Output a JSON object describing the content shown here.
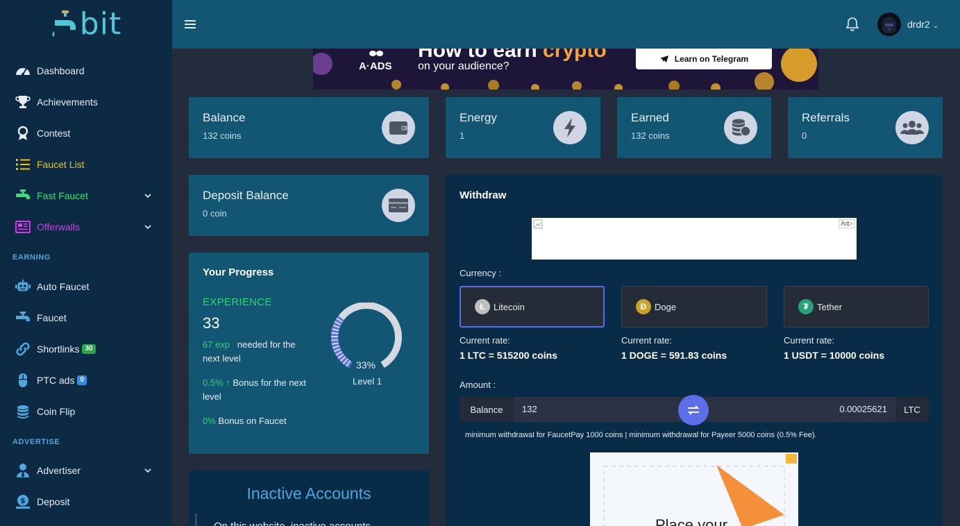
{
  "brand": {
    "logo_text": "bit"
  },
  "sidebar": {
    "items": [
      {
        "label": "Dashboard",
        "color": "#e6edf3"
      },
      {
        "label": "Achievements",
        "color": "#e6edf3"
      },
      {
        "label": "Contest",
        "color": "#e6edf3"
      },
      {
        "label": "Faucet List",
        "color": "#f5c400"
      },
      {
        "label": "Fast Faucet",
        "color": "#39e07a"
      },
      {
        "label": "Offerwalls",
        "color": "#d23ee3"
      }
    ],
    "sections": {
      "earning": "EARNING",
      "advertise": "ADVERTISE"
    },
    "earning_items": [
      {
        "label": "Auto Faucet"
      },
      {
        "label": "Faucet"
      },
      {
        "label": "Shortlinks",
        "badge": "30"
      },
      {
        "label": "PTC ads",
        "badge": "0"
      },
      {
        "label": "Coin Flip"
      }
    ],
    "advertise_items": [
      {
        "label": "Advertiser"
      },
      {
        "label": "Deposit"
      }
    ]
  },
  "header": {
    "username": "drdr2"
  },
  "banner": {
    "brand": "A·ADS",
    "headline_pre": "How to earn ",
    "headline_hl": "crypto",
    "subline": "on your audience?",
    "cta": "Learn on Telegram"
  },
  "stats": {
    "balance": {
      "title": "Balance",
      "value": "132 coins"
    },
    "energy": {
      "title": "Energy",
      "value": "1"
    },
    "earned": {
      "title": "Earned",
      "value": "132 coins"
    },
    "referrals": {
      "title": "Referrals",
      "value": "0"
    },
    "deposit": {
      "title": "Deposit Balance",
      "value": "0 coin"
    }
  },
  "progress": {
    "title": "Your Progress",
    "exp_label": "EXPERIENCE",
    "exp_value": "33",
    "needed_exp": "67 exp",
    "needed_text": "needed for the next level",
    "bonus_next_pct": "0.5%",
    "bonus_next_text": "Bonus for the next level",
    "bonus_faucet_pct": "0%",
    "bonus_faucet_text": "Bonus on Faucet",
    "percent_label": "33%",
    "percent": 33,
    "level": "Level 1"
  },
  "inactive": {
    "title": "Inactive Accounts",
    "text": "On this website, inactive accounts"
  },
  "withdraw": {
    "title": "Withdraw",
    "ad_tag": "Ad▷",
    "currency_label": "Currency :",
    "currencies": [
      {
        "name": "Litecoin",
        "glyph": "Ł",
        "color": "#bfbfbf",
        "rate_label": "Current rate:",
        "rate": "1 LTC = 515200 coins",
        "selected": true
      },
      {
        "name": "Doge",
        "glyph": "Ð",
        "color": "#c9a227",
        "rate_label": "Current rate:",
        "rate": "1 DOGE = 591.83 coins",
        "selected": false
      },
      {
        "name": "Tether",
        "glyph": "₮",
        "color": "#26a17b",
        "rate_label": "Current rate:",
        "rate": "1 USDT = 10000 coins",
        "selected": false
      }
    ],
    "amount_label": "Amount :",
    "balance_label": "Balance",
    "amount_value": "132",
    "converted_value": "0.00025621",
    "unit": "LTC",
    "min_note": "minimum withdrawal for FaucetPay 1000 coins | minimum withdrawal for Payeer 5000 coins (0.5% Fee).",
    "ad2_text": "Place your"
  }
}
